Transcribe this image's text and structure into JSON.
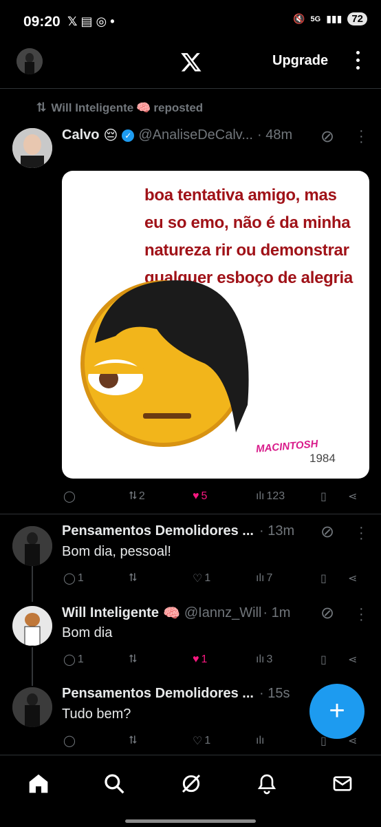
{
  "status": {
    "time": "09:20",
    "icons_left": "𝕏 ▤ ◎ •",
    "battery": "72",
    "signal": "5G"
  },
  "header": {
    "logo": "X",
    "upgrade_label": "Upgrade"
  },
  "repost_banner": {
    "user": "Will Inteligente",
    "emoji": "🧠",
    "suffix": "reposted"
  },
  "post": {
    "name": "Calvo",
    "emoji": "😔",
    "handle": "@AnaliseDeCalv...",
    "time": "· 48m",
    "image_text": "boa tentativa amigo, mas eu so emo, não é da minha natureza rir ou demonstrar qualquer esboço de alegria",
    "image_caption_top": "MACINTOSH",
    "image_caption_bottom": "1984",
    "retweets": "2",
    "likes": "5",
    "views": "123"
  },
  "replies": [
    {
      "name": "Pensamentos Demolidores ...",
      "handle": "",
      "time": "· 13m",
      "text": "Bom dia, pessoal!",
      "replies": "1",
      "retweets": "",
      "likes": "1",
      "views": "7",
      "liked": false
    },
    {
      "name": "Will Inteligente",
      "emoji": "🧠",
      "handle": "@Iannz_Will",
      "time": "· 1m",
      "text": "Bom dia",
      "replies": "1",
      "retweets": "",
      "likes": "1",
      "views": "3",
      "liked": true
    },
    {
      "name": "Pensamentos Demolidores ...",
      "handle": "",
      "time": "· 15s",
      "text": "Tudo bem?",
      "replies": "",
      "retweets": "",
      "likes": "1",
      "views": "",
      "liked": false
    }
  ],
  "colors": {
    "accent": "#1d9bf0",
    "like": "#f91880",
    "muted": "#71767b",
    "bg": "#000000"
  },
  "fab": {
    "label": "+"
  }
}
